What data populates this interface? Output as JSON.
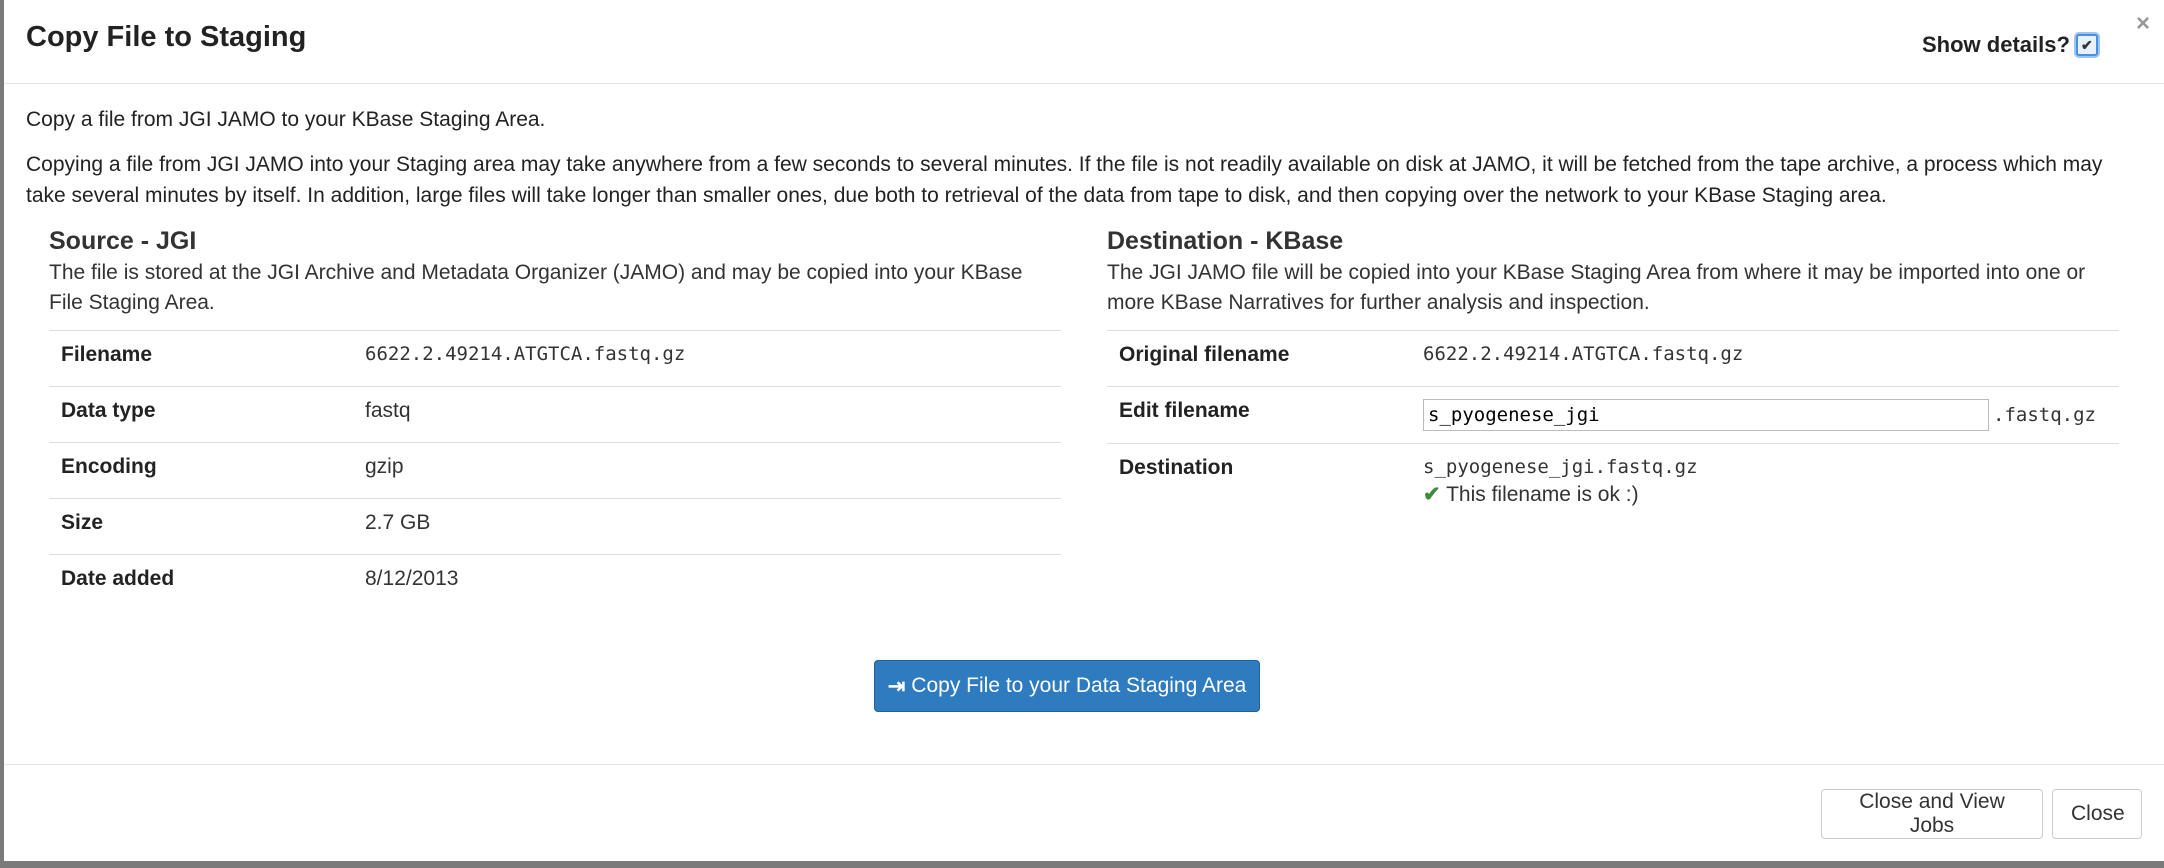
{
  "header": {
    "title": "Copy File to Staging",
    "show_details_label": "Show details?",
    "show_details_checked": true,
    "close_glyph": "×"
  },
  "intro": {
    "line1": "Copy a file from JGI JAMO to your KBase Staging Area.",
    "line2": "Copying a file from JGI JAMO into your Staging area may take anywhere from a few seconds to several minutes. If the file is not readily available on disk at JAMO, it will be fetched from the tape archive, a process which may take several minutes by itself. In addition, large files will take longer than smaller ones, due both to retrieval of the data from tape to disk, and then copying over the network to your KBase Staging area."
  },
  "source": {
    "title": "Source - JGI",
    "description": "The file is stored at the JGI Archive and Metadata Organizer (JAMO) and may be copied into your KBase File Staging Area.",
    "rows": [
      {
        "label": "Filename",
        "value": "6622.2.49214.ATGTCA.fastq.gz"
      },
      {
        "label": "Data type",
        "value": "fastq"
      },
      {
        "label": "Encoding",
        "value": "gzip"
      },
      {
        "label": "Size",
        "value": "2.7 GB"
      },
      {
        "label": "Date added",
        "value": "8/12/2013"
      }
    ]
  },
  "destination": {
    "title": "Destination - KBase",
    "description": "The JGI JAMO file will be copied into your KBase Staging Area from where it may be imported into one or more KBase Narratives for further analysis and inspection.",
    "original_label": "Original filename",
    "original_value": "6622.2.49214.ATGTCA.fastq.gz",
    "edit_label": "Edit filename",
    "edit_value": "s_pyogenese_jgi",
    "edit_ext": ".fastq.gz",
    "dest_label": "Destination",
    "dest_value": "s_pyogenese_jgi.fastq.gz",
    "ok_message": "This filename is ok :)"
  },
  "actions": {
    "copy_label": "Copy File to your Data Staging Area",
    "close_jobs_label": "Close and View Jobs",
    "close_label": "Close"
  },
  "icons": {
    "close": "close-icon",
    "checkmark": "check-icon",
    "copy": "sign-in-icon"
  },
  "colors": {
    "primary": "#2f7bbf",
    "success": "#3c8c3c"
  }
}
